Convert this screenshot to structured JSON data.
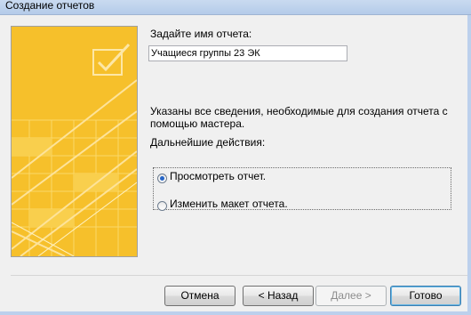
{
  "window": {
    "title": "Создание отчетов"
  },
  "form": {
    "name_prompt": "Задайте имя отчета:",
    "report_name": "Учащиеся группы 23 ЭК",
    "info": "Указаны все сведения, необходимые для создания отчета с помощью мастера.",
    "info_line1": "Указаны все сведения, необходимые для создания отчета с",
    "info_line2": "помощью мастера.",
    "next_actions": "Дальнейшие действия:",
    "options": [
      {
        "label": "Просмотреть отчет.",
        "selected": true
      },
      {
        "label": "Изменить макет отчета.",
        "selected": false
      }
    ]
  },
  "buttons": {
    "cancel": "Отмена",
    "back": "< Назад",
    "next": "Далее >",
    "finish": "Готово"
  },
  "colors": {
    "art_yellow": "#f6c02b",
    "title_bar": "#c9daf0"
  }
}
